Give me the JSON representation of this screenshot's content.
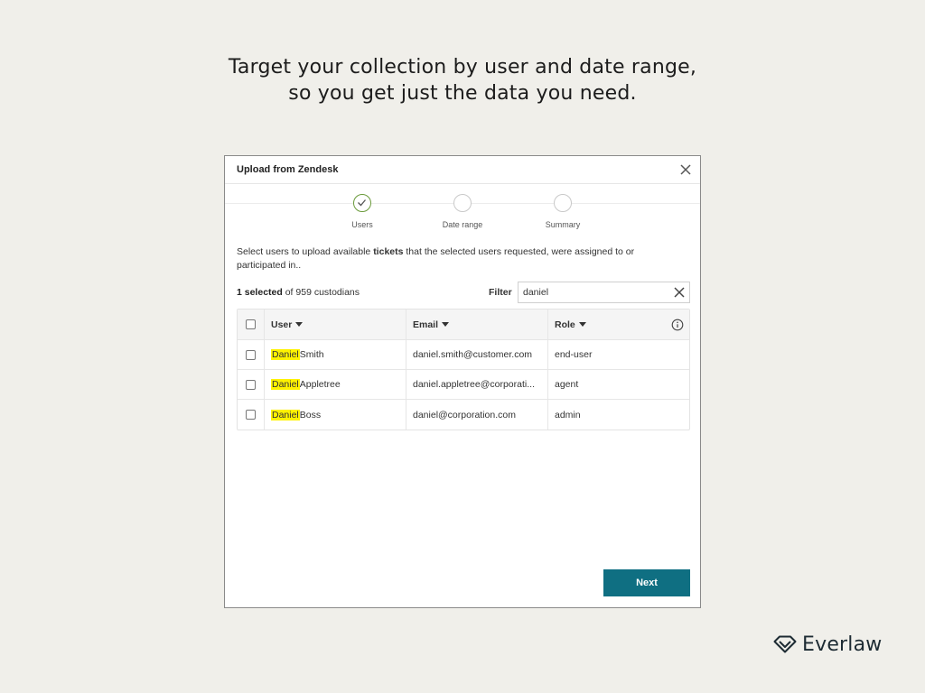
{
  "headline": {
    "line1": "Target your collection by user and date range,",
    "line2": "so you get just the data you need."
  },
  "dialog": {
    "title": "Upload from Zendesk",
    "steps": [
      {
        "label": "Users",
        "state": "complete"
      },
      {
        "label": "Date range",
        "state": "pending"
      },
      {
        "label": "Summary",
        "state": "pending"
      }
    ],
    "description_prefix": "Select users to upload available ",
    "description_bold": "tickets",
    "description_suffix": " that the selected users requested, were assigned to or participated in..",
    "selection": {
      "selected_label": "1 selected",
      "rest": " of 959 custodians"
    },
    "filter": {
      "label": "Filter",
      "value": "daniel"
    },
    "table": {
      "headers": {
        "user": "User",
        "email": "Email",
        "role": "Role"
      },
      "rows": [
        {
          "highlight": "Daniel",
          "name_rest": " Smith",
          "email": "daniel.smith@customer.com",
          "role": "end-user",
          "checked": false
        },
        {
          "highlight": "Daniel",
          "name_rest": " Appletree",
          "email": "daniel.appletree@corporati...",
          "role": "agent",
          "checked": false
        },
        {
          "highlight": "Daniel",
          "name_rest": " Boss",
          "email": "daniel@corporation.com",
          "role": "admin",
          "checked": false
        }
      ]
    },
    "next_label": "Next"
  },
  "brand": {
    "name": "Everlaw"
  },
  "colors": {
    "accent": "#0f6f82",
    "highlight": "#fff200",
    "check_green": "#6a9a3a",
    "background": "#f0efea"
  }
}
